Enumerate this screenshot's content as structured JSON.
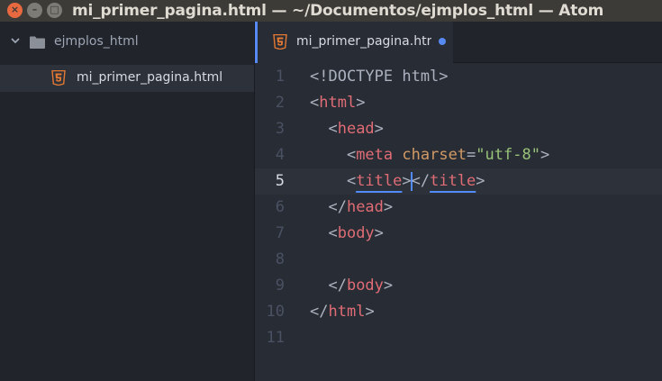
{
  "window": {
    "title": "mi_primer_pagina.html — ~/Documentos/ejmplos_html — Atom",
    "buttons": {
      "close": "×",
      "minimize": "–",
      "maximize": "□"
    }
  },
  "tree": {
    "folder": {
      "label": "ejmplos_html",
      "expanded": true
    },
    "files": [
      {
        "label": "mi_primer_pagina.html",
        "icon": "html5-icon",
        "selected": true
      }
    ]
  },
  "tabs": [
    {
      "label": "mi_primer_pagina.html",
      "modified": true,
      "active": true
    }
  ],
  "editor": {
    "current_line": 5,
    "lines": [
      {
        "n": "1",
        "parts": [
          {
            "t": "<!DOCTYPE html>",
            "c": "punc"
          }
        ]
      },
      {
        "n": "2",
        "parts": [
          {
            "t": "<",
            "c": "punc"
          },
          {
            "t": "html",
            "c": "tag"
          },
          {
            "t": ">",
            "c": "punc"
          }
        ]
      },
      {
        "n": "3",
        "parts": [
          {
            "t": "  <",
            "c": "punc"
          },
          {
            "t": "head",
            "c": "tag"
          },
          {
            "t": ">",
            "c": "punc"
          }
        ]
      },
      {
        "n": "4",
        "parts": [
          {
            "t": "    <",
            "c": "punc"
          },
          {
            "t": "meta",
            "c": "tag"
          },
          {
            "t": " ",
            "c": "punc"
          },
          {
            "t": "charset",
            "c": "attr"
          },
          {
            "t": "=",
            "c": "punc"
          },
          {
            "t": "\"utf-8\"",
            "c": "str"
          },
          {
            "t": ">",
            "c": "punc"
          }
        ]
      },
      {
        "n": "5",
        "parts": [
          {
            "t": "    <",
            "c": "punc"
          },
          {
            "t": "title",
            "c": "tag matched"
          },
          {
            "t": ">",
            "c": "punc"
          },
          {
            "cursor": true
          },
          {
            "t": "</",
            "c": "punc"
          },
          {
            "t": "title",
            "c": "tag matched"
          },
          {
            "t": ">",
            "c": "punc"
          }
        ]
      },
      {
        "n": "6",
        "parts": [
          {
            "t": "  </",
            "c": "punc"
          },
          {
            "t": "head",
            "c": "tag"
          },
          {
            "t": ">",
            "c": "punc"
          }
        ]
      },
      {
        "n": "7",
        "parts": [
          {
            "t": "  <",
            "c": "punc"
          },
          {
            "t": "body",
            "c": "tag"
          },
          {
            "t": ">",
            "c": "punc"
          }
        ]
      },
      {
        "n": "8",
        "parts": []
      },
      {
        "n": "9",
        "parts": [
          {
            "t": "  </",
            "c": "punc"
          },
          {
            "t": "body",
            "c": "tag"
          },
          {
            "t": ">",
            "c": "punc"
          }
        ]
      },
      {
        "n": "10",
        "parts": [
          {
            "t": "</",
            "c": "punc"
          },
          {
            "t": "html",
            "c": "tag"
          },
          {
            "t": ">",
            "c": "punc"
          }
        ]
      },
      {
        "n": "11",
        "parts": []
      }
    ]
  },
  "colors": {
    "accent": "#568af2",
    "tag": "#e06c75",
    "attribute": "#d19a66",
    "string": "#98c379",
    "html5_icon": "#e37933"
  }
}
